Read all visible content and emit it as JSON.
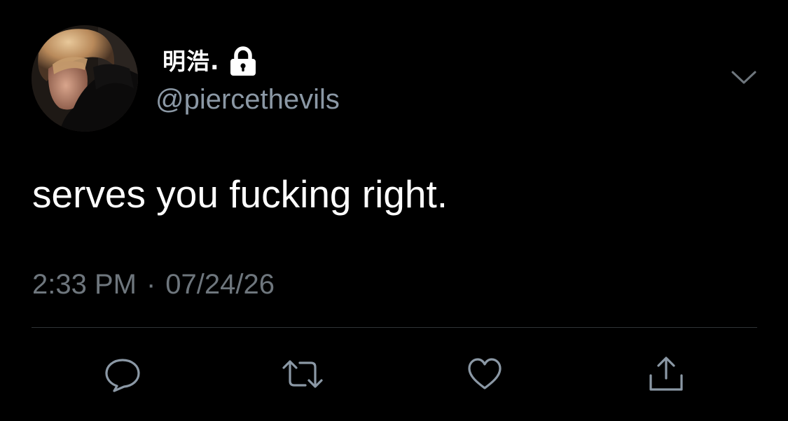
{
  "user": {
    "display_name": "明浩.",
    "handle": "@piercethevils",
    "protected_icon": "lock-icon",
    "avatar": "profile-photo"
  },
  "tweet": {
    "text": "serves you fucking right.",
    "time": "2:33 PM",
    "separator": "·",
    "date": "07/24/26"
  },
  "actions": [
    {
      "name": "reply",
      "icon": "reply-icon"
    },
    {
      "name": "retweet",
      "icon": "retweet-icon"
    },
    {
      "name": "like",
      "icon": "heart-icon"
    },
    {
      "name": "share",
      "icon": "share-icon"
    }
  ],
  "menu_icon": "chevron-down-icon",
  "colors": {
    "background": "#000000",
    "primary_text": "#ffffff",
    "handle_text": "#8b98a5",
    "meta_text": "#6e767d",
    "icon": "#8b98a5",
    "divider": "#2f3336"
  }
}
